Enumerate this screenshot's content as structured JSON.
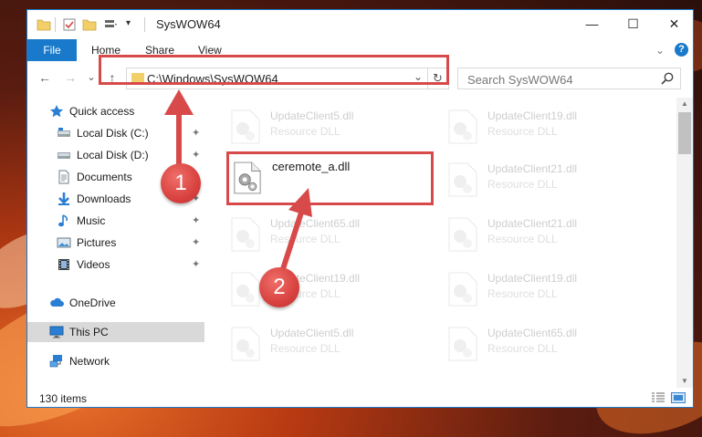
{
  "window": {
    "title": "SysWOW64",
    "controls": {
      "minimize": "—",
      "maximize": "☐",
      "close": "✕"
    }
  },
  "ribbon": {
    "tabs": [
      {
        "label": "File",
        "active": true
      },
      {
        "label": "Home"
      },
      {
        "label": "Share"
      },
      {
        "label": "View"
      }
    ],
    "collapse_glyph": "⌄",
    "help_glyph": "?"
  },
  "navigation": {
    "back_glyph": "←",
    "forward_glyph": "→",
    "recent_glyph": "⌄",
    "up_glyph": "↑",
    "address": "C:\\Windows\\SysWOW64",
    "address_dropdown_glyph": "⌄",
    "refresh_glyph": "↻",
    "search_placeholder": "Search SysWOW64"
  },
  "sidebar": {
    "items": [
      {
        "label": "Quick access",
        "icon": "star-icon",
        "pinned": false
      },
      {
        "label": "Local Disk (C:)",
        "icon": "drive-icon",
        "pinned": true
      },
      {
        "label": "Local Disk (D:)",
        "icon": "drive-icon",
        "pinned": true
      },
      {
        "label": "Documents",
        "icon": "document-icon",
        "pinned": true
      },
      {
        "label": "Downloads",
        "icon": "download-icon",
        "pinned": true
      },
      {
        "label": "Music",
        "icon": "music-icon",
        "pinned": true
      },
      {
        "label": "Pictures",
        "icon": "pictures-icon",
        "pinned": true
      },
      {
        "label": "Videos",
        "icon": "video-icon",
        "pinned": true
      },
      {
        "label": "OneDrive",
        "icon": "cloud-icon",
        "pinned": false
      },
      {
        "label": "This PC",
        "icon": "computer-icon",
        "pinned": false,
        "selected": true
      },
      {
        "label": "Network",
        "icon": "network-icon",
        "pinned": false
      }
    ],
    "pin_glyph": "📌"
  },
  "files": [
    {
      "name": "UpdateClient5.dll",
      "type": "Resource DLL"
    },
    {
      "name": "UpdateClient19.dll",
      "type": "Resource DLL"
    },
    {
      "name": "ceremote_a.dll",
      "type": ""
    },
    {
      "name": "UpdateClient21.dll",
      "type": "Resource DLL"
    },
    {
      "name": "UpdateClient65.dll",
      "type": "Resource DLL"
    },
    {
      "name": "UpdateClient21.dll",
      "type": "Resource DLL"
    },
    {
      "name": "UpdateClient19.dll",
      "type": "Resource DLL"
    },
    {
      "name": "UpdateClient19.dll",
      "type": "Resource DLL"
    },
    {
      "name": "UpdateClient5.dll",
      "type": "Resource DLL"
    },
    {
      "name": "UpdateClient65.dll",
      "type": "Resource DLL"
    }
  ],
  "status": {
    "item_count": "130 items"
  },
  "annotations": {
    "step1": "1",
    "step2": "2",
    "color": "#d8494a"
  }
}
